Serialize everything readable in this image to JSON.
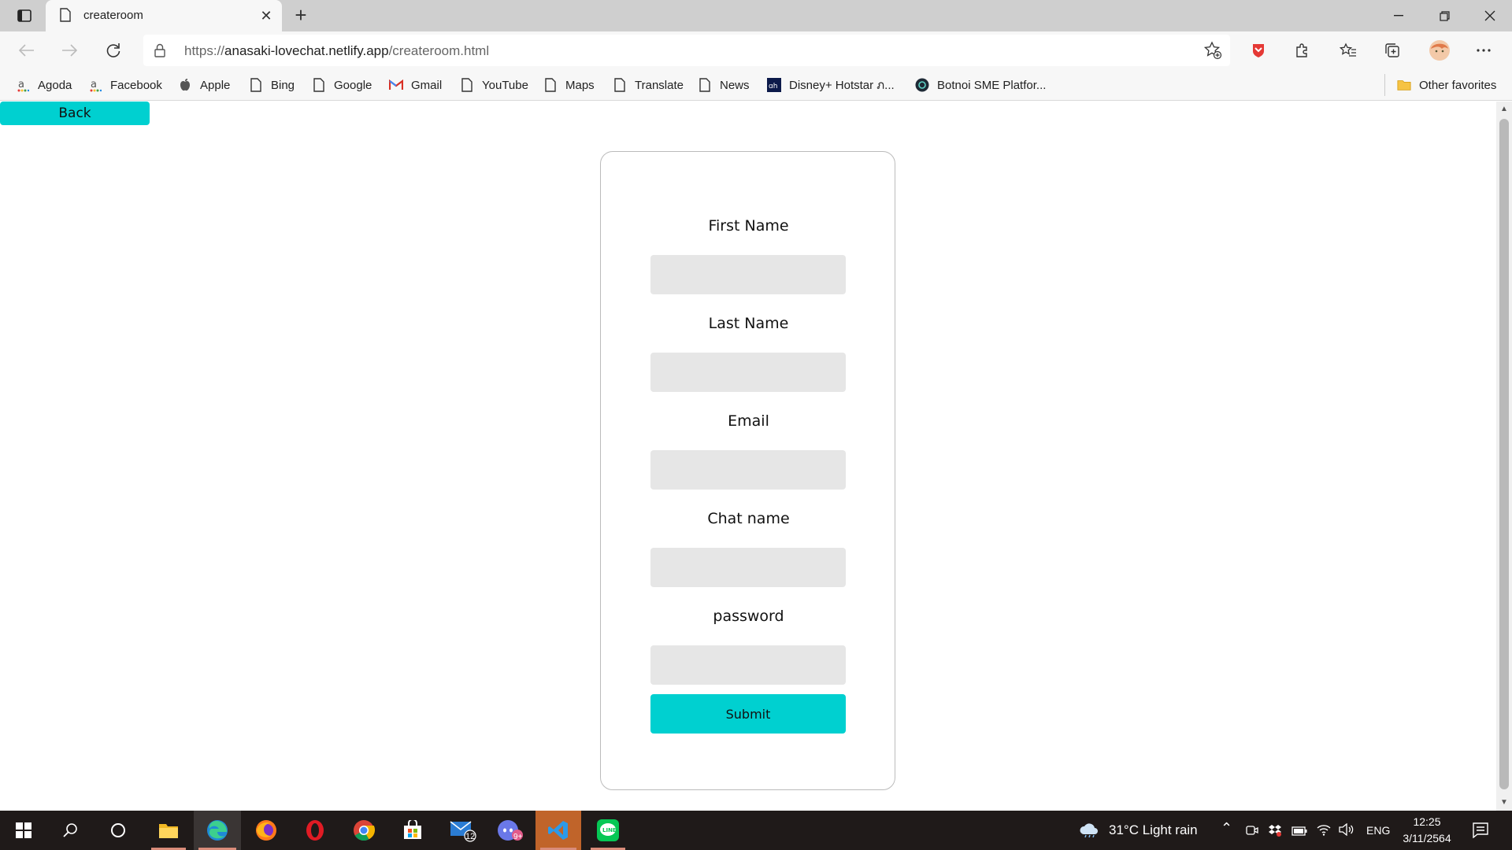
{
  "browser": {
    "tab_title": "createroom",
    "url_prefix": "https://",
    "url_host": "anasaki-lovechat.netlify.app",
    "url_path": "/createroom.html"
  },
  "bookmarks": [
    {
      "label": "Agoda",
      "icon": "agoda-icon"
    },
    {
      "label": "Facebook",
      "icon": "facebook-icon"
    },
    {
      "label": "Apple",
      "icon": "apple-icon"
    },
    {
      "label": "Bing",
      "icon": "page-icon"
    },
    {
      "label": "Google",
      "icon": "page-icon"
    },
    {
      "label": "Gmail",
      "icon": "gmail-icon"
    },
    {
      "label": "YouTube",
      "icon": "page-icon"
    },
    {
      "label": "Maps",
      "icon": "page-icon"
    },
    {
      "label": "Translate",
      "icon": "page-icon"
    },
    {
      "label": "News",
      "icon": "page-icon"
    },
    {
      "label": "Disney+ Hotstar ภ...",
      "icon": "hotstar-icon"
    },
    {
      "label": "Botnoi SME Platfor...",
      "icon": "botnoi-icon"
    }
  ],
  "other_favorites": "Other favorites",
  "page": {
    "back_label": "Back",
    "fields": [
      {
        "label": "First Name"
      },
      {
        "label": "Last Name"
      },
      {
        "label": "Email"
      },
      {
        "label": "Chat name"
      },
      {
        "label": "password"
      }
    ],
    "submit_label": "Submit",
    "accent_color": "#00d0d0",
    "input_bg_color": "#e6e6e6"
  },
  "taskbar": {
    "weather": "31°C  Light rain",
    "language": "ENG",
    "time": "12:25",
    "date": "3/11/2564",
    "mail_badge": "12",
    "discord_badge": "9+"
  }
}
